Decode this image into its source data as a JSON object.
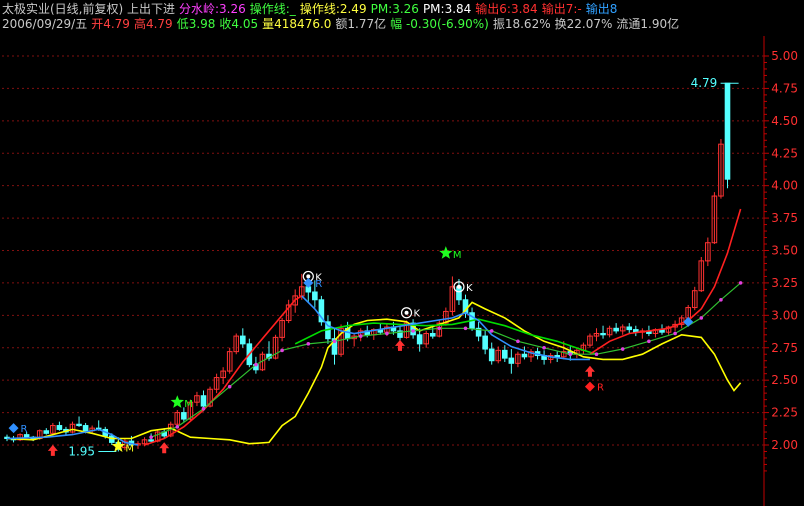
{
  "header": {
    "line1": [
      {
        "text": "太极实业(日线,前复权) 上出下进",
        "color": "#c8c8c8"
      },
      {
        "text": "分水岭:3.26",
        "color": "#ff40ff"
      },
      {
        "text": "操作线:_",
        "color": "#40ff40"
      },
      {
        "text": "操作线:2.49",
        "color": "#ffff40"
      },
      {
        "text": "PM:3.26",
        "color": "#40ff40"
      },
      {
        "text": "PM:3.84",
        "color": "#ffffff"
      },
      {
        "text": "输出6:3.84",
        "color": "#ff3030"
      },
      {
        "text": "输出7:-",
        "color": "#ff3030"
      },
      {
        "text": "输出8",
        "color": "#30a0ff"
      }
    ],
    "line2": [
      {
        "text": "2006/09/29/五",
        "color": "#c8c8c8"
      },
      {
        "text": "开4.79",
        "color": "#ff4040"
      },
      {
        "text": "高4.79",
        "color": "#ff4040"
      },
      {
        "text": "低3.98",
        "color": "#40ff40"
      },
      {
        "text": "收4.05",
        "color": "#40ff40"
      },
      {
        "text": "量418476.0",
        "color": "#ffff40"
      },
      {
        "text": "额1.77亿",
        "color": "#c8c8c8"
      },
      {
        "text": "幅 -0.30(-6.90%)",
        "color": "#40ff40"
      },
      {
        "text": "振18.62%",
        "color": "#c8c8c8"
      },
      {
        "text": "换22.07%",
        "color": "#c8c8c8"
      },
      {
        "text": "流通1.90亿",
        "color": "#c8c8c8"
      }
    ]
  },
  "colors": {
    "up": "#ff3232",
    "down": "#54ffff",
    "grid": "#801010",
    "axis": "#c00000",
    "axis_text": "#ff3030",
    "yellow": "#ffff00",
    "green": "#00dd00",
    "red_line": "#ff2020",
    "blue_line": "#3090ff",
    "magenta": "#e040e0"
  },
  "chart_data": {
    "type": "candlestick",
    "ylim": [
      1.75,
      5.15
    ],
    "yticks": [
      "2.00",
      "2.25",
      "2.50",
      "2.75",
      "3.00",
      "3.25",
      "3.50",
      "3.75",
      "4.00",
      "4.25",
      "4.50",
      "4.75",
      "5.00"
    ],
    "candles": [
      [
        2.06,
        2.08,
        2.03,
        2.05
      ],
      [
        2.05,
        2.07,
        2.02,
        2.04
      ],
      [
        2.04,
        2.09,
        2.03,
        2.08
      ],
      [
        2.08,
        2.1,
        2.05,
        2.06
      ],
      [
        2.06,
        2.07,
        2.03,
        2.05
      ],
      [
        2.05,
        2.12,
        2.04,
        2.11
      ],
      [
        2.11,
        2.13,
        2.08,
        2.09
      ],
      [
        2.09,
        2.17,
        2.08,
        2.15
      ],
      [
        2.15,
        2.18,
        2.11,
        2.12
      ],
      [
        2.12,
        2.14,
        2.08,
        2.1
      ],
      [
        2.1,
        2.18,
        2.09,
        2.16
      ],
      [
        2.16,
        2.22,
        2.14,
        2.15
      ],
      [
        2.15,
        2.17,
        2.09,
        2.11
      ],
      [
        2.11,
        2.15,
        2.09,
        2.13
      ],
      [
        2.13,
        2.19,
        2.11,
        2.12
      ],
      [
        2.12,
        2.14,
        2.05,
        2.07
      ],
      [
        2.07,
        2.09,
        2.0,
        2.02
      ],
      [
        2.02,
        2.06,
        1.95,
        1.98
      ],
      [
        1.98,
        2.05,
        1.96,
        2.03
      ],
      [
        2.03,
        2.07,
        1.99,
        2.0
      ],
      [
        2.0,
        2.03,
        1.97,
        2.01
      ],
      [
        2.01,
        2.06,
        1.99,
        2.04
      ],
      [
        2.04,
        2.09,
        2.02,
        2.03
      ],
      [
        2.03,
        2.12,
        2.02,
        2.1
      ],
      [
        2.1,
        2.13,
        2.05,
        2.07
      ],
      [
        2.07,
        2.18,
        2.06,
        2.16
      ],
      [
        2.16,
        2.27,
        2.14,
        2.25
      ],
      [
        2.25,
        2.29,
        2.18,
        2.2
      ],
      [
        2.2,
        2.35,
        2.19,
        2.33
      ],
      [
        2.33,
        2.41,
        2.3,
        2.38
      ],
      [
        2.38,
        2.42,
        2.26,
        2.3
      ],
      [
        2.3,
        2.45,
        2.29,
        2.43
      ],
      [
        2.43,
        2.55,
        2.4,
        2.52
      ],
      [
        2.52,
        2.6,
        2.47,
        2.57
      ],
      [
        2.57,
        2.75,
        2.55,
        2.72
      ],
      [
        2.72,
        2.86,
        2.7,
        2.84
      ],
      [
        2.84,
        2.9,
        2.75,
        2.78
      ],
      [
        2.78,
        2.82,
        2.6,
        2.62
      ],
      [
        2.62,
        2.68,
        2.55,
        2.58
      ],
      [
        2.58,
        2.72,
        2.57,
        2.7
      ],
      [
        2.7,
        2.8,
        2.65,
        2.67
      ],
      [
        2.67,
        2.85,
        2.66,
        2.83
      ],
      [
        2.83,
        2.98,
        2.8,
        2.96
      ],
      [
        2.96,
        3.12,
        2.94,
        3.08
      ],
      [
        3.08,
        3.2,
        3.02,
        3.15
      ],
      [
        3.15,
        3.32,
        3.12,
        3.22
      ],
      [
        3.22,
        3.3,
        3.1,
        3.18
      ],
      [
        3.18,
        3.27,
        3.06,
        3.12
      ],
      [
        3.12,
        3.15,
        2.92,
        2.95
      ],
      [
        2.95,
        3.0,
        2.78,
        2.82
      ],
      [
        2.82,
        2.9,
        2.62,
        2.7
      ],
      [
        2.7,
        2.93,
        2.68,
        2.9
      ],
      [
        2.9,
        2.95,
        2.8,
        2.82
      ],
      [
        2.82,
        2.86,
        2.76,
        2.84
      ],
      [
        2.84,
        2.9,
        2.8,
        2.88
      ],
      [
        2.88,
        2.92,
        2.83,
        2.85
      ],
      [
        2.85,
        2.9,
        2.81,
        2.89
      ],
      [
        2.89,
        2.94,
        2.85,
        2.87
      ],
      [
        2.87,
        2.93,
        2.84,
        2.91
      ],
      [
        2.91,
        2.95,
        2.85,
        2.88
      ],
      [
        2.88,
        2.92,
        2.8,
        2.83
      ],
      [
        2.83,
        2.96,
        2.82,
        2.94
      ],
      [
        2.94,
        2.97,
        2.82,
        2.85
      ],
      [
        2.85,
        2.9,
        2.72,
        2.78
      ],
      [
        2.78,
        2.88,
        2.75,
        2.86
      ],
      [
        2.86,
        2.92,
        2.82,
        2.84
      ],
      [
        2.84,
        2.96,
        2.83,
        2.94
      ],
      [
        2.94,
        3.06,
        2.92,
        3.03
      ],
      [
        3.03,
        3.3,
        3.0,
        3.22
      ],
      [
        3.22,
        3.28,
        3.08,
        3.12
      ],
      [
        3.12,
        3.16,
        2.98,
        3.02
      ],
      [
        3.02,
        3.06,
        2.88,
        2.9
      ],
      [
        2.9,
        2.95,
        2.8,
        2.84
      ],
      [
        2.84,
        2.88,
        2.7,
        2.74
      ],
      [
        2.74,
        2.79,
        2.62,
        2.65
      ],
      [
        2.65,
        2.76,
        2.63,
        2.73
      ],
      [
        2.73,
        2.77,
        2.64,
        2.67
      ],
      [
        2.67,
        2.74,
        2.55,
        2.63
      ],
      [
        2.63,
        2.72,
        2.6,
        2.7
      ],
      [
        2.7,
        2.76,
        2.66,
        2.68
      ],
      [
        2.68,
        2.74,
        2.64,
        2.72
      ],
      [
        2.72,
        2.75,
        2.66,
        2.69
      ],
      [
        2.69,
        2.73,
        2.62,
        2.66
      ],
      [
        2.66,
        2.71,
        2.63,
        2.69
      ],
      [
        2.69,
        2.72,
        2.64,
        2.68
      ],
      [
        2.68,
        2.8,
        2.66,
        2.72
      ],
      [
        2.72,
        2.76,
        2.65,
        2.7
      ],
      [
        2.7,
        2.75,
        2.67,
        2.73
      ],
      [
        2.73,
        2.79,
        2.7,
        2.77
      ],
      [
        2.77,
        2.86,
        2.75,
        2.84
      ],
      [
        2.84,
        2.9,
        2.8,
        2.86
      ],
      [
        2.86,
        2.92,
        2.82,
        2.85
      ],
      [
        2.85,
        2.92,
        2.83,
        2.9
      ],
      [
        2.9,
        2.94,
        2.86,
        2.88
      ],
      [
        2.88,
        2.93,
        2.85,
        2.91
      ],
      [
        2.91,
        2.94,
        2.86,
        2.89
      ],
      [
        2.89,
        2.92,
        2.84,
        2.87
      ],
      [
        2.87,
        2.9,
        2.82,
        2.88
      ],
      [
        2.88,
        2.92,
        2.84,
        2.86
      ],
      [
        2.86,
        2.9,
        2.83,
        2.89
      ],
      [
        2.89,
        2.93,
        2.85,
        2.87
      ],
      [
        2.87,
        2.92,
        2.85,
        2.91
      ],
      [
        2.91,
        2.96,
        2.88,
        2.93
      ],
      [
        2.93,
        3.0,
        2.9,
        2.98
      ],
      [
        2.98,
        3.08,
        2.95,
        3.06
      ],
      [
        3.06,
        3.22,
        3.04,
        3.19
      ],
      [
        3.19,
        3.45,
        3.18,
        3.42
      ],
      [
        3.42,
        3.6,
        3.38,
        3.56
      ],
      [
        3.56,
        3.95,
        3.55,
        3.92
      ],
      [
        3.92,
        4.36,
        3.9,
        4.32
      ],
      [
        4.79,
        4.79,
        3.98,
        4.05
      ]
    ],
    "yellow_line": [
      [
        0,
        2.05
      ],
      [
        4,
        2.04
      ],
      [
        7,
        2.08
      ],
      [
        10,
        2.12
      ],
      [
        13,
        2.09
      ],
      [
        16,
        2.05
      ],
      [
        19,
        2.05
      ],
      [
        22,
        2.11
      ],
      [
        25,
        2.13
      ],
      [
        28,
        2.06
      ],
      [
        31,
        2.05
      ],
      [
        34,
        2.04
      ],
      [
        37,
        2.01
      ],
      [
        40,
        2.02
      ],
      [
        42,
        2.15
      ],
      [
        44,
        2.22
      ],
      [
        46,
        2.4
      ],
      [
        48,
        2.6
      ],
      [
        49,
        2.75
      ],
      [
        51,
        2.86
      ],
      [
        53,
        2.93
      ],
      [
        55,
        2.96
      ],
      [
        58,
        2.97
      ],
      [
        61,
        2.95
      ],
      [
        63,
        2.88
      ],
      [
        66,
        2.93
      ],
      [
        69,
        2.98
      ],
      [
        71,
        3.1
      ],
      [
        73,
        3.05
      ],
      [
        76,
        2.98
      ],
      [
        79,
        2.88
      ],
      [
        82,
        2.8
      ],
      [
        85,
        2.75
      ],
      [
        88,
        2.68
      ],
      [
        91,
        2.66
      ],
      [
        94,
        2.66
      ],
      [
        97,
        2.7
      ],
      [
        100,
        2.78
      ],
      [
        103,
        2.85
      ],
      [
        106,
        2.83
      ],
      [
        108,
        2.7
      ],
      [
        110,
        2.5
      ],
      [
        111,
        2.42
      ],
      [
        112,
        2.48
      ]
    ],
    "green_line": [
      [
        44,
        2.78
      ],
      [
        48,
        2.88
      ],
      [
        52,
        2.92
      ],
      [
        56,
        2.94
      ],
      [
        60,
        2.93
      ],
      [
        64,
        2.92
      ],
      [
        68,
        2.93
      ],
      [
        72,
        2.97
      ],
      [
        76,
        2.92
      ],
      [
        80,
        2.85
      ],
      [
        84,
        2.8
      ],
      [
        88,
        2.73
      ],
      [
        90,
        2.7
      ]
    ],
    "red_line": [
      [
        21,
        2.0
      ],
      [
        24,
        2.05
      ],
      [
        27,
        2.14
      ],
      [
        30,
        2.27
      ],
      [
        33,
        2.43
      ],
      [
        36,
        2.64
      ],
      [
        39,
        2.82
      ],
      [
        42,
        3.0
      ],
      [
        44,
        3.12
      ],
      [
        45,
        3.15
      ],
      [
        89,
        2.7
      ],
      [
        92,
        2.8
      ],
      [
        95,
        2.86
      ],
      [
        98,
        2.88
      ],
      [
        101,
        2.9
      ],
      [
        104,
        2.96
      ],
      [
        106,
        3.05
      ],
      [
        108,
        3.22
      ],
      [
        110,
        3.48
      ],
      [
        112,
        3.82
      ]
    ],
    "blue_line": [
      [
        0,
        2.05
      ],
      [
        6,
        2.06
      ],
      [
        10,
        2.08
      ],
      [
        14,
        2.12
      ],
      [
        16,
        2.08
      ],
      [
        18,
        2.02
      ],
      [
        20,
        2.0
      ],
      [
        45,
        3.15
      ],
      [
        47,
        3.05
      ],
      [
        49,
        2.92
      ],
      [
        51,
        2.88
      ],
      [
        53,
        2.86
      ],
      [
        68,
        2.98
      ],
      [
        70,
        3.02
      ],
      [
        72,
        2.96
      ],
      [
        74,
        2.85
      ],
      [
        77,
        2.76
      ],
      [
        80,
        2.71
      ],
      [
        83,
        2.68
      ],
      [
        86,
        2.66
      ],
      [
        89,
        2.66
      ]
    ],
    "dotted_line": [
      [
        22,
        2.06
      ],
      [
        26,
        2.14
      ],
      [
        30,
        2.28
      ],
      [
        34,
        2.45
      ],
      [
        38,
        2.62
      ],
      [
        42,
        2.73
      ],
      [
        46,
        2.78
      ],
      [
        50,
        2.8
      ],
      [
        54,
        2.84
      ],
      [
        58,
        2.86
      ],
      [
        62,
        2.88
      ],
      [
        66,
        2.9
      ],
      [
        70,
        2.9
      ],
      [
        74,
        2.88
      ],
      [
        78,
        2.8
      ],
      [
        82,
        2.75
      ],
      [
        86,
        2.7
      ],
      [
        90,
        2.7
      ],
      [
        94,
        2.74
      ],
      [
        98,
        2.8
      ],
      [
        102,
        2.86
      ],
      [
        106,
        2.98
      ],
      [
        109,
        3.12
      ],
      [
        112,
        3.25
      ]
    ],
    "annotations": [
      {
        "type": "price_label",
        "text": "4.79",
        "i": 112,
        "v": 4.79,
        "color": "#54ffff"
      },
      {
        "type": "price_label",
        "text": "1.95",
        "i": 17,
        "v": 1.95,
        "color": "#54ffff"
      },
      {
        "type": "star",
        "i": 26,
        "v": 2.33,
        "color": "#20ff20",
        "text": "M"
      },
      {
        "type": "star",
        "i": 17,
        "v": 1.99,
        "color": "#ffff20",
        "text": "M"
      },
      {
        "type": "star",
        "i": 67,
        "v": 3.48,
        "color": "#20ff20",
        "text": "M"
      },
      {
        "type": "circle_k",
        "i": 46,
        "v": 3.3,
        "text": "K"
      },
      {
        "type": "circle_k",
        "i": 61,
        "v": 3.02,
        "text": "K"
      },
      {
        "type": "circle_k",
        "i": 69,
        "v": 3.22,
        "text": "K"
      },
      {
        "type": "diamond_r",
        "i": 1,
        "v": 2.13,
        "color": "#3090ff",
        "text": "R"
      },
      {
        "type": "diamond_r",
        "i": 46,
        "v": 3.25,
        "color": "#3090ff",
        "text": "R"
      },
      {
        "type": "diamond_r",
        "i": 89,
        "v": 2.45,
        "color": "#ff2020",
        "text": "R"
      },
      {
        "type": "diamond_r",
        "i": 104,
        "v": 2.95,
        "color": "#3090ff",
        "text": ""
      },
      {
        "type": "up_arrow",
        "i": 7,
        "v": 1.97
      },
      {
        "type": "up_arrow",
        "i": 24,
        "v": 1.99
      },
      {
        "type": "up_arrow",
        "i": 60,
        "v": 2.78
      },
      {
        "type": "up_arrow",
        "i": 89,
        "v": 2.58
      }
    ]
  }
}
